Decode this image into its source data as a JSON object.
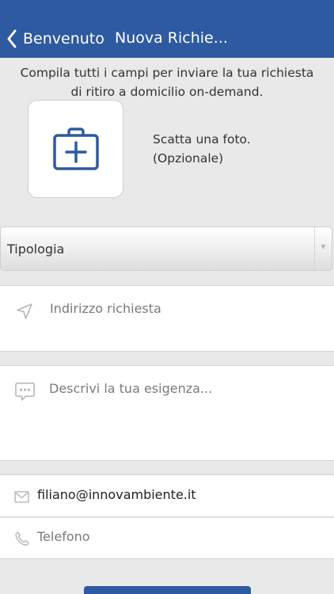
{
  "navbar": {
    "back_label": "Benvenuto",
    "title": "Nuova Richie..."
  },
  "intro": {
    "line1": "Compila tutti i campi per inviare la tua richiesta",
    "line2": "di ritiro a domicilio on-demand."
  },
  "photo": {
    "line1": "Scatta una foto.",
    "line2": "(Opzionale)",
    "icon": "camera-add-icon"
  },
  "type_select": {
    "selected": "Tipologia",
    "arrow": "▼"
  },
  "address": {
    "placeholder": "Indirizzo richiesta",
    "icon": "location-arrow-icon"
  },
  "description": {
    "placeholder": "Descrivi la tua esigenza...",
    "icon": "chat-bubble-icon"
  },
  "email": {
    "value": "filiano@innovambiente.it",
    "icon": "mail-icon"
  },
  "phone": {
    "placeholder": "Telefono",
    "icon": "phone-icon"
  },
  "colors": {
    "navbar": "#2d5aa0",
    "background": "#e9e9e9",
    "icon_accent": "#2d5aa0",
    "icon_muted": "#b5b5b5"
  }
}
